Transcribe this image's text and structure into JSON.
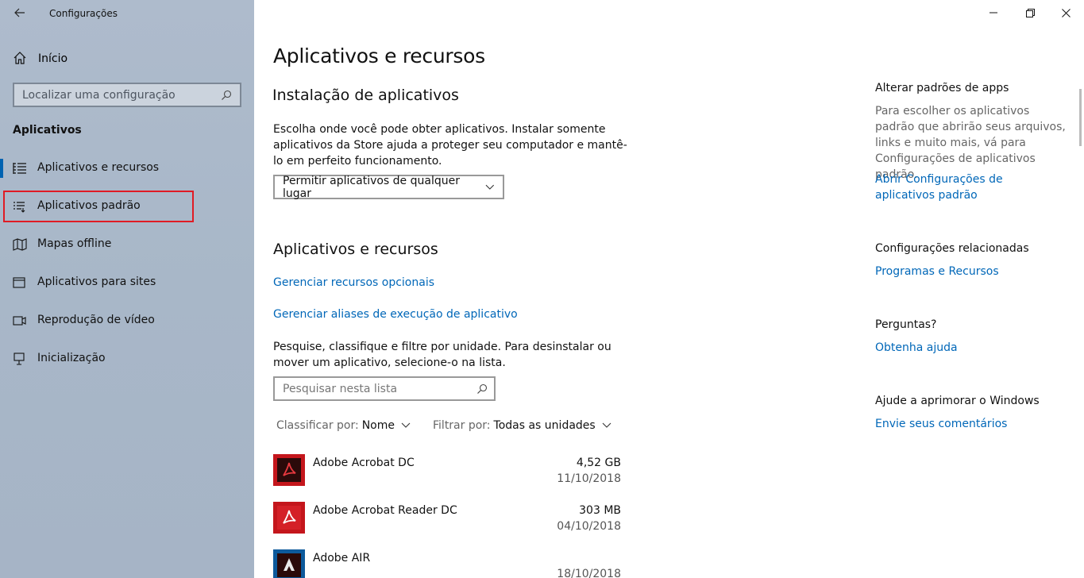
{
  "window": {
    "title": "Configurações"
  },
  "sidebar": {
    "home_label": "Início",
    "search_placeholder": "Localizar uma configuração",
    "section_title": "Aplicativos",
    "items": [
      {
        "label": "Aplicativos e recursos",
        "icon": "apps-features-icon",
        "selected": true
      },
      {
        "label": "Aplicativos padrão",
        "icon": "default-apps-icon",
        "highlighted": true
      },
      {
        "label": "Mapas offline",
        "icon": "map-icon"
      },
      {
        "label": "Aplicativos para sites",
        "icon": "apps-websites-icon"
      },
      {
        "label": "Reprodução de vídeo",
        "icon": "video-icon"
      },
      {
        "label": "Inicialização",
        "icon": "startup-icon"
      }
    ]
  },
  "main": {
    "title": "Aplicativos e recursos",
    "install": {
      "heading": "Instalação de aplicativos",
      "description": "Escolha onde você pode obter aplicativos. Instalar somente aplicativos da Store ajuda a proteger seu computador e mantê-lo em perfeito funcionamento.",
      "dropdown_value": "Permitir aplicativos de qualquer lugar"
    },
    "apps": {
      "heading": "Aplicativos e recursos",
      "link_optional": "Gerenciar recursos opcionais",
      "link_aliases": "Gerenciar aliases de execução de aplicativo",
      "description": "Pesquise, classifique e filtre por unidade. Para desinstalar ou mover um aplicativo, selecione-o na lista.",
      "search_placeholder": "Pesquisar nesta lista",
      "sort_label": "Classificar por:",
      "sort_value": "Nome",
      "filter_label": "Filtrar por:",
      "filter_value": "Todas as unidades",
      "list": [
        {
          "name": "Adobe Acrobat DC",
          "size": "4,52 GB",
          "date": "11/10/2018",
          "icon": "acrobat-icon"
        },
        {
          "name": "Adobe Acrobat Reader DC",
          "size": "303 MB",
          "date": "04/10/2018",
          "icon": "acrobat-reader-icon"
        },
        {
          "name": "Adobe AIR",
          "size": "",
          "date": "18/10/2018",
          "icon": "adobe-air-icon"
        }
      ]
    }
  },
  "right": {
    "defaults_heading": "Alterar padrões de apps",
    "defaults_text": "Para escolher os aplicativos padrão que abrirão seus arquivos, links e muito mais, vá para Configurações de aplicativos padrão.",
    "defaults_link": "Abrir Configurações de aplicativos padrão",
    "related_heading": "Configurações relacionadas",
    "related_link": "Programas e Recursos",
    "questions_heading": "Perguntas?",
    "questions_link": "Obtenha ajuda",
    "improve_heading": "Ajude a aprimorar o Windows",
    "improve_link": "Envie seus comentários"
  },
  "colors": {
    "accent": "#0063b1",
    "link": "#0067b8",
    "highlight": "#e01b24",
    "acrobat_red": "#c4161c"
  }
}
